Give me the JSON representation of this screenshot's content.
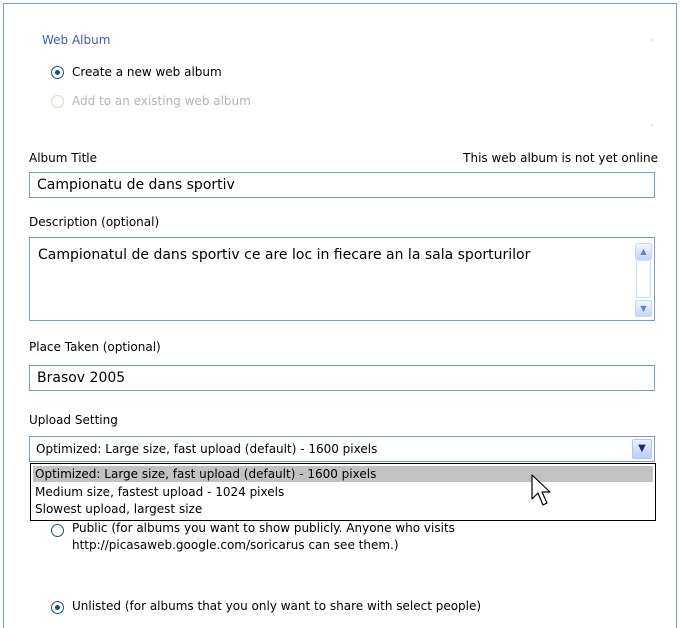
{
  "web_album": {
    "section_title": "Web Album",
    "options": [
      {
        "label": "Create a new web album",
        "selected": true,
        "enabled": true
      },
      {
        "label": "Add to an existing web album",
        "selected": false,
        "enabled": false
      }
    ]
  },
  "album_title": {
    "label": "Album Title",
    "status": "This web album is not yet online",
    "value": "Campionatu de dans sportiv"
  },
  "description": {
    "label": "Description (optional)",
    "value": "Campionatul de dans sportiv ce are loc in fiecare an la sala sporturilor"
  },
  "place_taken": {
    "label": "Place Taken (optional)",
    "value": "Brasov 2005"
  },
  "upload_setting": {
    "label": "Upload Setting",
    "selected": "Optimized: Large size, fast upload (default) - 1600 pixels",
    "options": [
      "Optimized: Large size, fast upload (default) - 1600 pixels",
      "Medium size, fastest upload - 1024 pixels",
      "Slowest upload, largest size"
    ],
    "highlighted_index": 0
  },
  "privacy": {
    "public": {
      "line1": "Public (for albums you want to show publicly. Anyone who visits",
      "line2": "http://picasaweb.google.com/soricarus can see them.)",
      "selected": false
    },
    "unlisted": {
      "label": "Unlisted (for albums that you only want to share with select people)",
      "selected": true
    }
  },
  "icons": {
    "scroll_up": "scroll-up-arrow-icon",
    "scroll_down": "scroll-down-arrow-icon",
    "dropdown": "chevron-down-icon",
    "cursor": "mouse-pointer-icon"
  }
}
